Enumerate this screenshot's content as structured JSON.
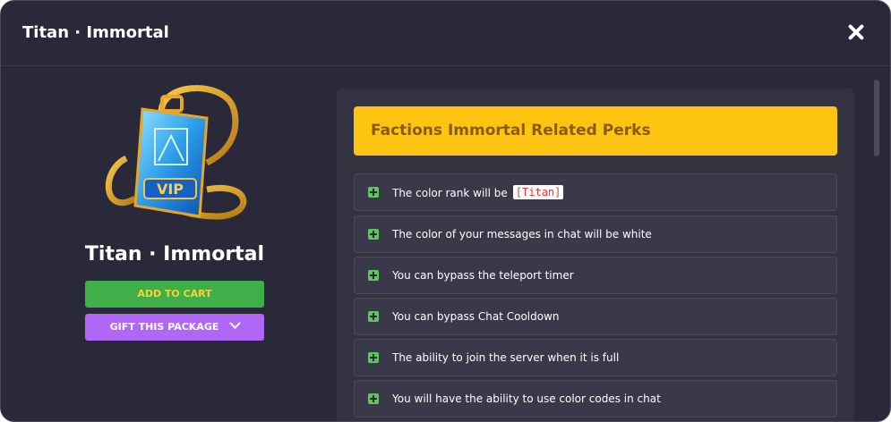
{
  "header": {
    "title": "Titan · Immortal"
  },
  "product": {
    "name": "Titan · Immortal",
    "add_to_cart": "ADD TO CART",
    "gift": "GIFT THIS PACKAGE",
    "image_text": "VIP"
  },
  "perks": {
    "title": "Factions Immortal Related Perks",
    "items": [
      {
        "text": "The color rank will be",
        "badge": "[Titan]"
      },
      {
        "text": "The color of your messages in chat will be white"
      },
      {
        "text": "You can bypass the teleport timer"
      },
      {
        "text": "You can bypass Chat Cooldown"
      },
      {
        "text": "The ability to join the server when it is full"
      },
      {
        "text": "You will have the ability to use color codes in chat"
      }
    ]
  },
  "colors": {
    "background": "#2a2939",
    "panel": "#33323f",
    "accent_yellow": "#fdc411",
    "add_green": "#3faf49",
    "gift_purple": "#b067f5",
    "plus_green": "#5ec65a"
  }
}
